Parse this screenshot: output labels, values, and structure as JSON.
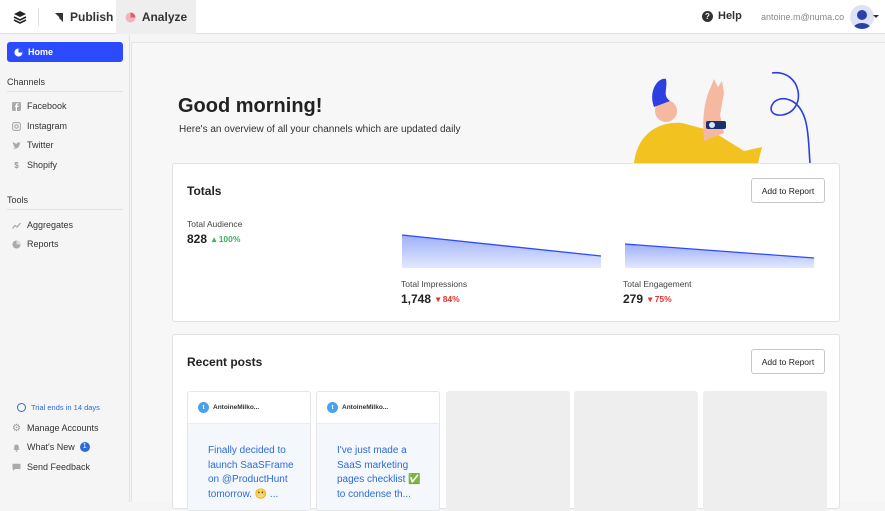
{
  "topbar": {
    "tabs": [
      {
        "label": "Publish",
        "icon": "paper-plane-icon"
      },
      {
        "label": "Analyze",
        "icon": "pie-chart-icon",
        "active": true
      }
    ],
    "help_label": "Help",
    "user_email": "antoine.m@numa.co"
  },
  "sidebar": {
    "home_label": "Home",
    "channels_heading": "Channels",
    "channels": [
      {
        "label": "Facebook",
        "icon": "facebook-icon"
      },
      {
        "label": "Instagram",
        "icon": "instagram-icon"
      },
      {
        "label": "Twitter",
        "icon": "twitter-icon"
      },
      {
        "label": "Shopify",
        "icon": "shopify-icon"
      }
    ],
    "tools_heading": "Tools",
    "tools": [
      {
        "label": "Aggregates",
        "icon": "line-chart-icon"
      },
      {
        "label": "Reports",
        "icon": "pie-chart-icon"
      }
    ],
    "trial_text": "Trial ends in 14 days",
    "bottom": [
      {
        "label": "Manage Accounts",
        "icon": "gear-icon"
      },
      {
        "label": "What's New",
        "icon": "bell-icon",
        "badge": "1"
      },
      {
        "label": "Send Feedback",
        "icon": "chat-icon"
      }
    ]
  },
  "main": {
    "greeting": "Good morning!",
    "subtitle": "Here's an overview of all your channels which are updated daily",
    "totals": {
      "title": "Totals",
      "report_button": "Add to Report",
      "audience": {
        "label": "Total Audience",
        "value": "828",
        "change": "100%",
        "direction": "up"
      },
      "impressions": {
        "label": "Total Impressions",
        "value": "1,748",
        "change": "84%",
        "direction": "down"
      },
      "engagement": {
        "label": "Total Engagement",
        "value": "279",
        "change": "75%",
        "direction": "down"
      }
    },
    "recent_posts": {
      "title": "Recent posts",
      "report_button": "Add to Report",
      "posts": [
        {
          "author": "AntoineMilko...",
          "text": "Finally decided to launch SaaSFrame on @ProductHunt tomorrow. 😬 ..."
        },
        {
          "author": "AntoineMilko...",
          "text": "I've just made a SaaS marketing pages checklist ✅ to condense th..."
        }
      ]
    }
  },
  "colors": {
    "accent": "#2c4bff",
    "link": "#2c6bd8",
    "up": "#3db25a",
    "down": "#e2342d"
  }
}
